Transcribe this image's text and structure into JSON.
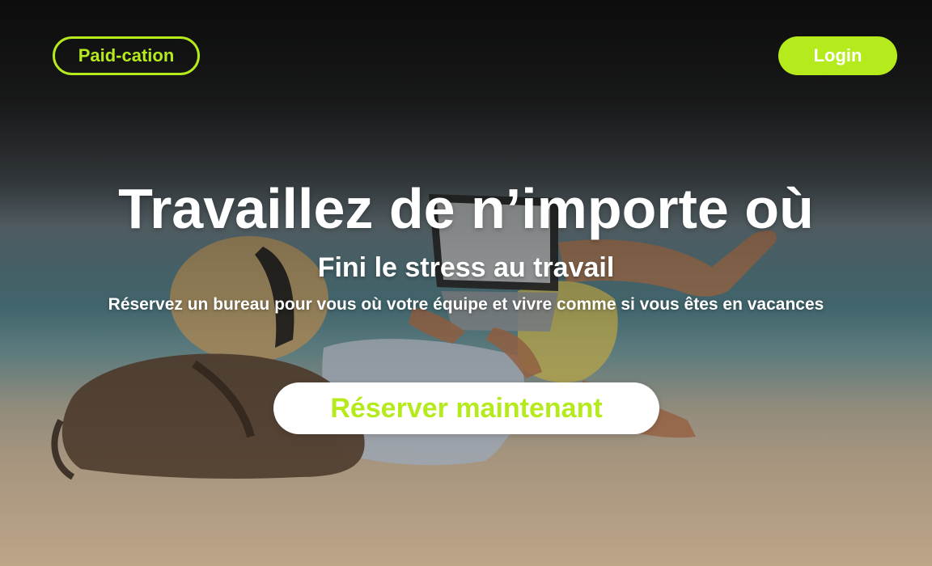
{
  "header": {
    "logo_label": "Paid-cation",
    "login_label": "Login"
  },
  "hero": {
    "headline": "Travaillez de n’importe où",
    "subheadline": "Fini le stress au travail",
    "tagline": "Réservez un bureau pour vous où votre équipe et vivre comme si vous êtes en vacances",
    "cta_label": "Réserver maintenant",
    "background_image": "person-on-beach-with-laptop"
  },
  "colors": {
    "accent": "#b5ea1d",
    "text_light": "#ffffff",
    "cta_background": "#ffffff"
  }
}
